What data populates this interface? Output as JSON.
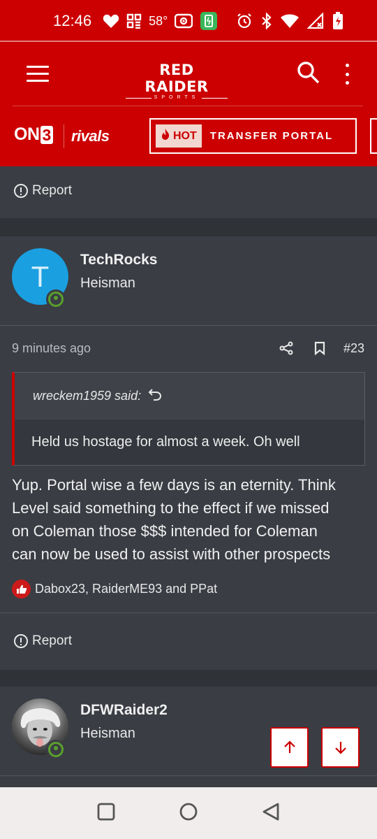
{
  "status_bar": {
    "time": "12:46",
    "temperature": "58°",
    "icons": [
      "heart-icon",
      "grid-app-icon",
      "hotspot-icon",
      "battery-saver-icon",
      "alarm-icon",
      "bluetooth-icon",
      "wifi-icon",
      "signal-icon",
      "battery-charging-icon"
    ]
  },
  "header": {
    "brand_main": "RED RAIDER",
    "brand_sub": "SPORTS"
  },
  "sub_nav": {
    "on3_text": "ON",
    "on3_three": "3",
    "rivals": "rivals",
    "hot_label": "HOT",
    "portal_label": "TRANSFER PORTAL"
  },
  "prev_post_footer": {
    "report_label": "Report"
  },
  "post1": {
    "avatar_letter": "T",
    "username": "TechRocks",
    "rank": "Heisman",
    "timestamp": "9 minutes ago",
    "post_number": "#23",
    "quote_author": "wreckem1959 said:",
    "quote_text": "Held us hostage for almost a week. Oh well",
    "body_lines": [
      "Yup. Portal wise a few days is an eternity. Think",
      "Level said something to the effect if we missed",
      "on Coleman those $$$ intended for Coleman",
      "can now be used to assist with other prospects"
    ],
    "reactions": "Dabox23, RaiderME93 and PPat",
    "report_label": "Report"
  },
  "post2": {
    "username": "DFWRaider2",
    "rank": "Heisman"
  },
  "colors": {
    "brand_red": "#cc0000",
    "background": "#3a3d44",
    "online_green": "#5aa02c",
    "avatar_blue": "#1a9fe0"
  }
}
